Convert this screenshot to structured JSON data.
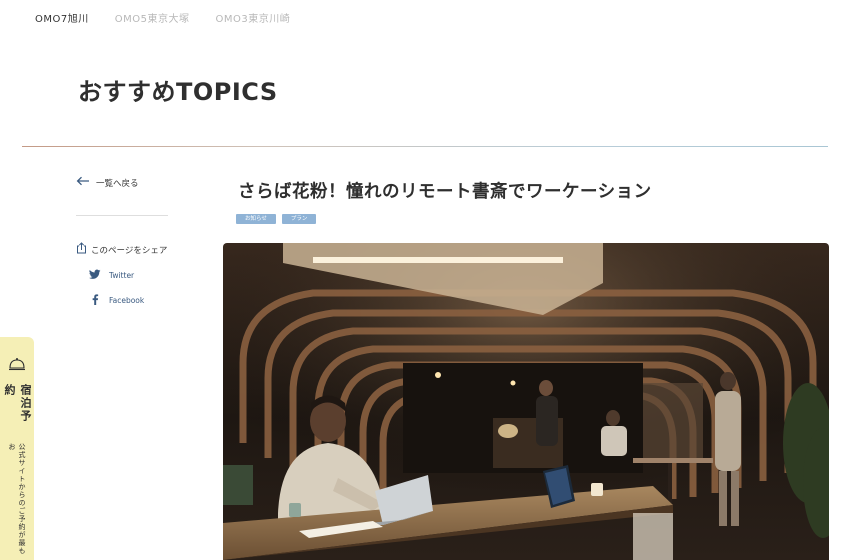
{
  "top_nav": {
    "tabs": [
      "OMO7旭川",
      "OMO5東京大塚",
      "OMO3東京川崎"
    ]
  },
  "section": {
    "title": "おすすめTOPICS"
  },
  "sidebar": {
    "back_label": "一覧へ戻る",
    "share_label": "このページをシェア",
    "twitter_label": "Twitter",
    "facebook_label": "Facebook"
  },
  "article": {
    "title": "さらば花粉！憧れのリモート書斎でワーケーション",
    "tags": [
      "お知らせ",
      "プラン"
    ]
  },
  "booking_tab": {
    "label": "宿泊予約",
    "sub": "公式サイトからのご予約が最もお"
  },
  "colors": {
    "tag_bg": "#8fb3d6",
    "booking_bg": "#f5efb6",
    "divider_left": "#c49a86",
    "divider_right": "#a9c6d4"
  }
}
